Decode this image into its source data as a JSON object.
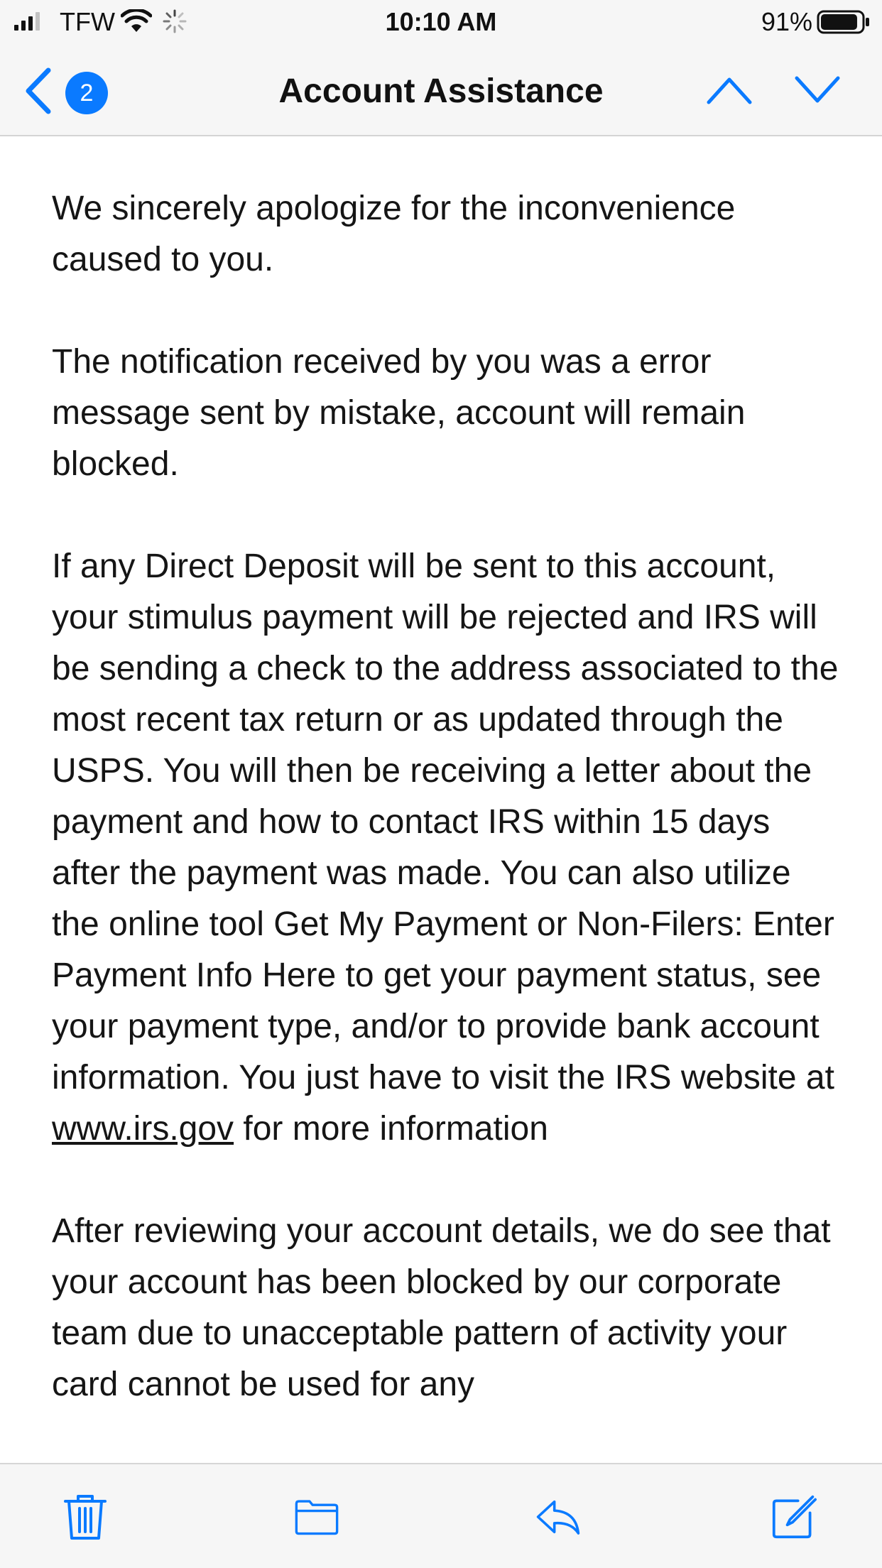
{
  "status_bar": {
    "carrier": "TFW",
    "time": "10:10 AM",
    "battery_percent": "91%",
    "battery_level": 0.91,
    "icons": [
      "signal-icon",
      "wifi-icon",
      "activity-spinner-icon",
      "battery-icon"
    ]
  },
  "nav": {
    "title": "Account Assistance",
    "unread_badge": "2",
    "icons": [
      "back-chevron-icon",
      "previous-message-icon",
      "next-message-icon"
    ]
  },
  "message": {
    "paragraphs": [
      "We sincerely apologize for the inconvenience caused to you.",
      "The notification received by you was a error message sent by mistake, account will remain blocked."
    ],
    "p3_before_link": "If any Direct Deposit will be sent to this account, your stimulus payment will be rejected and IRS will be sending a check to the address associated to the most recent tax return or as updated through the USPS. You will then be receiving a letter about the payment and how to contact IRS within 15 days after the payment was made. You can also utilize the online tool Get My Payment or Non-Filers: Enter Payment Info Here to get your payment status, see your payment type, and/or to provide bank account information. You just have to visit the IRS website at ",
    "p3_link": "www.irs.gov",
    "p3_after_link": " for more information",
    "p4": "After reviewing your account details, we do see that your account has been blocked by our corporate team due to unacceptable pattern of activity your card cannot be used for any"
  },
  "toolbar": {
    "icons": [
      "trash-icon",
      "folder-icon",
      "reply-icon",
      "compose-icon"
    ]
  },
  "colors": {
    "accent": "#0a7aff",
    "bar_background": "#f6f6f6",
    "text": "#151515"
  }
}
